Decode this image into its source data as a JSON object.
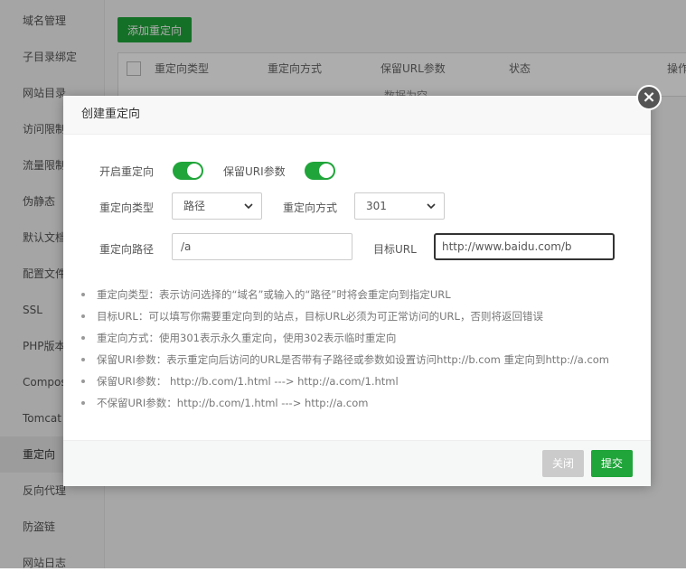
{
  "sidebar": {
    "items": [
      {
        "label": "域名管理"
      },
      {
        "label": "子目录绑定"
      },
      {
        "label": "网站目录"
      },
      {
        "label": "访问限制"
      },
      {
        "label": "流量限制"
      },
      {
        "label": "伪静态"
      },
      {
        "label": "默认文档"
      },
      {
        "label": "配置文件"
      },
      {
        "label": "SSL"
      },
      {
        "label": "PHP版本"
      },
      {
        "label": "Composer"
      },
      {
        "label": "Tomcat"
      },
      {
        "label": "重定向"
      },
      {
        "label": "反向代理"
      },
      {
        "label": "防盗链"
      },
      {
        "label": "网站日志"
      }
    ],
    "active_index": 12
  },
  "main": {
    "add_button": "添加重定向",
    "table": {
      "headers": [
        "重定向类型",
        "重定向方式",
        "保留URL参数",
        "状态",
        "操作"
      ],
      "partial_row": "数据为空"
    }
  },
  "modal": {
    "title": "创建重定向",
    "enable_redirect_label": "开启重定向",
    "enable_redirect": true,
    "keep_uri_label": "保留URI参数",
    "keep_uri": true,
    "redirect_type_label": "重定向类型",
    "redirect_type_value": "路径",
    "redirect_method_label": "重定向方式",
    "redirect_method_value": "301",
    "redirect_path_label": "重定向路径",
    "redirect_path_value": "/a",
    "target_url_label": "目标URL",
    "target_url_value": "http://www.baidu.com/b",
    "tips": [
      "重定向类型：表示访问选择的“域名”或输入的“路径”时将会重定向到指定URL",
      "目标URL：可以填写你需要重定向到的站点，目标URL必须为可正常访问的URL，否则将返回错误",
      "重定向方式：使用301表示永久重定向，使用302表示临时重定向",
      "保留URI参数：表示重定向后访问的URL是否带有子路径或参数如设置访问http://b.com 重定向到http://a.com",
      "保留URI参数： http://b.com/1.html ---> http://a.com/1.html",
      "不保留URI参数：http://b.com/1.html ---> http://a.com"
    ],
    "close_button": "关闭",
    "submit_button": "提交"
  },
  "colors": {
    "accent": "#20a53a",
    "disabled": "#cbcbcb"
  },
  "icons": {
    "close": "close-icon",
    "select_chevron": "chevron-down-icon"
  }
}
